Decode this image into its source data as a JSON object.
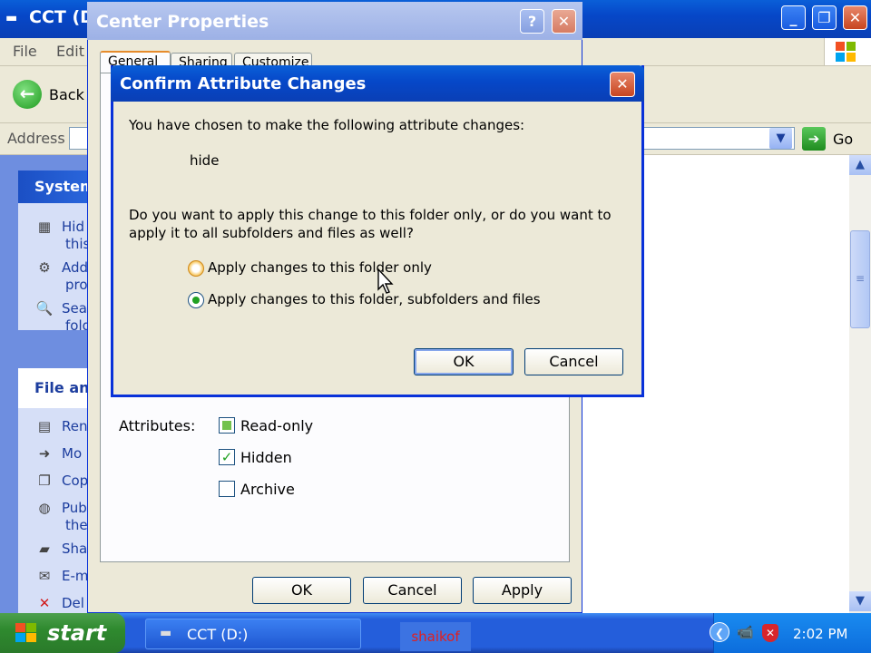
{
  "explorer": {
    "title": "CCT (D",
    "menu": [
      "File",
      "Edit"
    ],
    "back_label": "Back",
    "address_label": "Address",
    "go_label": "Go",
    "system_tasks": {
      "header": "System",
      "items": [
        {
          "line1": "Hid",
          "line2": "this"
        },
        {
          "line1": "Add",
          "line2": "pro"
        },
        {
          "line1": "Sea",
          "line2": "fold"
        }
      ]
    },
    "file_tasks": {
      "header": "File and",
      "items": [
        {
          "line1": "Ren",
          "line2": ""
        },
        {
          "line1": "Mo",
          "line2": ""
        },
        {
          "line1": "Cop",
          "line2": ""
        },
        {
          "line1": "Pub",
          "line2": "the"
        },
        {
          "line1": "Sha",
          "line2": ""
        },
        {
          "line1": "E-m",
          "line2": ""
        },
        {
          "line1": "Del",
          "line2": ""
        }
      ]
    }
  },
  "properties": {
    "title": "Center Properties",
    "tabs": [
      "General",
      "Sharing",
      "Customize"
    ],
    "attributes_label": "Attributes:",
    "attributes": [
      {
        "label": "Read-only",
        "state": "partial"
      },
      {
        "label": "Hidden",
        "state": "checked"
      },
      {
        "label": "Archive",
        "state": "unchecked"
      }
    ],
    "ok_label": "OK",
    "cancel_label": "Cancel",
    "apply_label": "Apply"
  },
  "confirm": {
    "title": "Confirm Attribute Changes",
    "message": "You have chosen to make the following attribute changes:",
    "change": "hide",
    "question": "Do you want to apply this change to this folder only, or do you want to apply it to all subfolders and files as well?",
    "options": [
      {
        "label": "Apply changes to this folder only",
        "selected": false
      },
      {
        "label": "Apply changes to this folder, subfolders and files",
        "selected": true
      }
    ],
    "ok_label": "OK",
    "cancel_label": "Cancel"
  },
  "taskbar": {
    "start_label": "start",
    "task_label": "CCT (D:)",
    "watermark": "shaikof",
    "clock": "2:02 PM"
  },
  "colors": {
    "title_blue": "#0a5fd8",
    "taskbar_blue": "#245edb",
    "start_green": "#2f8a2f",
    "close_red": "#c74520"
  }
}
